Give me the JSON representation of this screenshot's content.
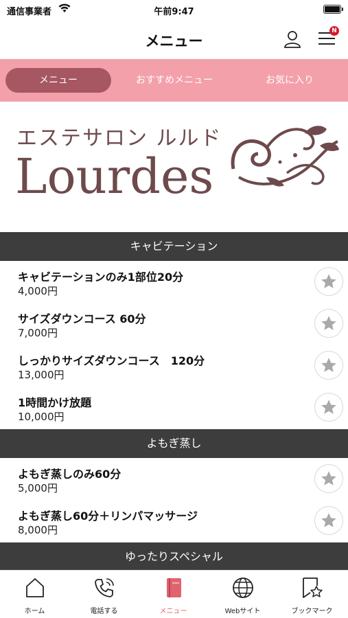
{
  "status_bar": {
    "carrier": "通信事業者",
    "time": "午前9:47"
  },
  "nav": {
    "title": "メニュー",
    "notification_badge": "N"
  },
  "tabs": [
    {
      "label": "メニュー",
      "active": true
    },
    {
      "label": "おすすめメニュー",
      "active": false
    },
    {
      "label": "お気に入り",
      "active": false
    }
  ],
  "banner": {
    "japanese_name": "エステサロン ルルド",
    "english_name": "Lourdes"
  },
  "sections": [
    {
      "title": "キャビテーション",
      "items": [
        {
          "name": "キャビテーションのみ1部位20分",
          "price": "4,000円"
        },
        {
          "name": "サイズダウンコース 60分",
          "price": "7,000円"
        },
        {
          "name": "しっかりサイズダウンコース　120分",
          "price": "13,000円"
        },
        {
          "name": "1時間かけ放題",
          "price": "10,000円"
        }
      ]
    },
    {
      "title": "よもぎ蒸し",
      "items": [
        {
          "name": "よもぎ蒸しのみ60分",
          "price": "5,000円"
        },
        {
          "name": "よもぎ蒸し60分＋リンパマッサージ",
          "price": "8,000円"
        }
      ]
    },
    {
      "title": "ゆったりスペシャル",
      "items": []
    }
  ],
  "bottom_nav": [
    {
      "label": "ホーム",
      "icon": "home-icon"
    },
    {
      "label": "電話する",
      "icon": "phone-icon"
    },
    {
      "label": "メニュー",
      "icon": "menu-book-icon",
      "active": true
    },
    {
      "label": "Webサイト",
      "icon": "globe-icon"
    },
    {
      "label": "ブックマーク",
      "icon": "bookmark-icon"
    }
  ],
  "colors": {
    "tab_bar": "#f3a0ab",
    "tab_active": "#a75762",
    "section_header": "#3d3d3d",
    "active_nav": "#e0646f",
    "brand_text": "#6e4a4c",
    "star": "#a9a9a9"
  }
}
